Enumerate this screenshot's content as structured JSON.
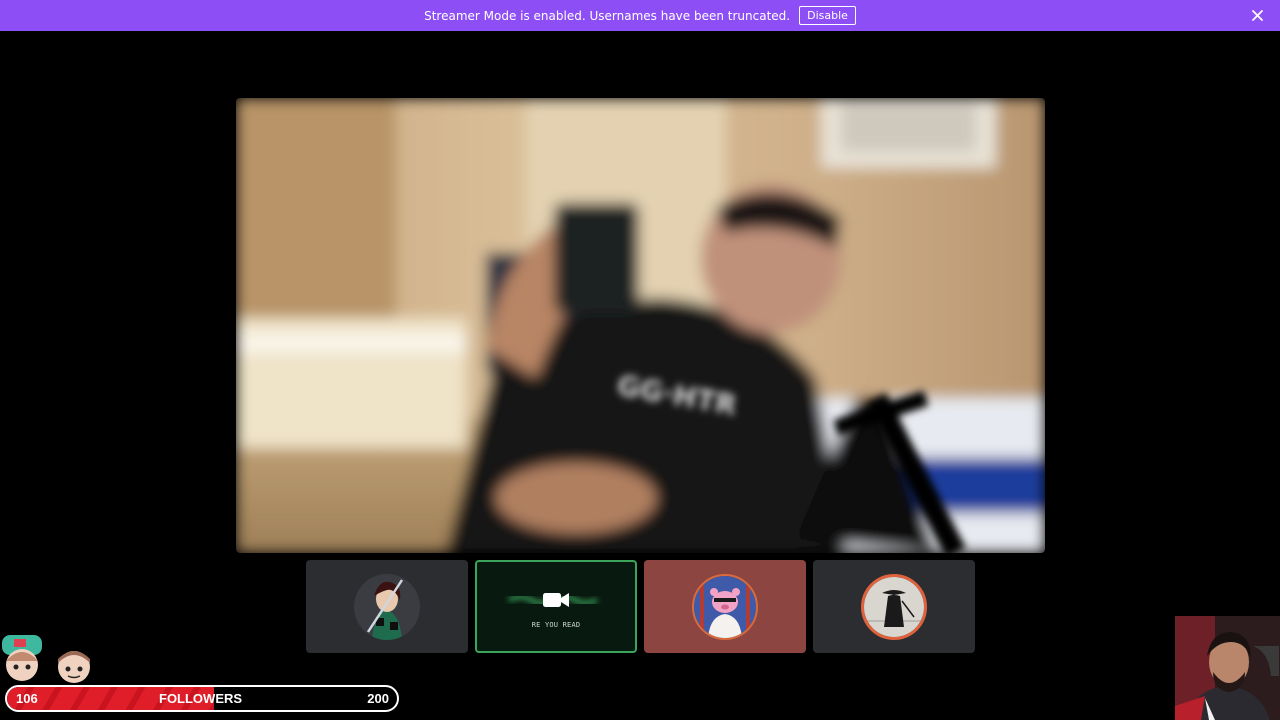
{
  "banner": {
    "message": "Streamer Mode is enabled. Usernames have been truncated.",
    "button_label": "Disable",
    "close_icon": "close-icon",
    "color": "#8d4ef5"
  },
  "main_video": {
    "content": "blurred-webcam-stream"
  },
  "tiles": [
    {
      "icon": "avatar-anime-swordsman",
      "background": "#2b2d31"
    },
    {
      "icon": "video-camera-icon",
      "caption": "RE YOU READ",
      "background": "#081a0f",
      "speaking_border": "#3ba55c"
    },
    {
      "icon": "avatar-pink-bear",
      "background": "#8c4540"
    },
    {
      "icon": "avatar-samurai-silhouette",
      "background": "#2b2d31"
    }
  ],
  "followers": {
    "current": "106",
    "label": "FOLLOWERS",
    "goal": "200",
    "progress": 0.53,
    "fill_color": "#e01e2a"
  },
  "emotes": [
    "emote-character-1",
    "emote-character-2"
  ],
  "facecam": {
    "content": "streamer-webcam"
  }
}
